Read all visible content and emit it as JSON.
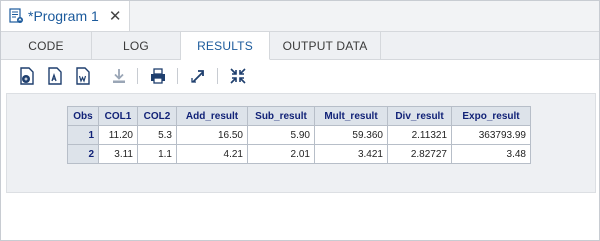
{
  "program_tab": {
    "title": "*Program 1",
    "close_icon": "close-icon"
  },
  "subtabs": [
    {
      "label": "CODE",
      "active": false
    },
    {
      "label": "LOG",
      "active": false
    },
    {
      "label": "RESULTS",
      "active": true
    },
    {
      "label": "OUTPUT DATA",
      "active": false
    }
  ],
  "toolbar": {
    "icons": [
      "download-html-icon",
      "download-pdf-icon",
      "download-rtf-icon",
      "download-icon",
      "print-icon",
      "expand-icon",
      "collapse-icon"
    ]
  },
  "table": {
    "headers": [
      "Obs",
      "COL1",
      "COL2",
      "Add_result",
      "Sub_result",
      "Mult_result",
      "Div_result",
      "Expo_result"
    ],
    "rows": [
      [
        "1",
        "11.20",
        "5.3",
        "16.50",
        "5.90",
        "59.360",
        "2.11321",
        "363793.99"
      ],
      [
        "2",
        "3.11",
        "1.1",
        "4.21",
        "2.01",
        "3.421",
        "2.82727",
        "3.48"
      ]
    ]
  },
  "colors": {
    "accent": "#1b5a9c",
    "header_bg": "#dde3ea",
    "header_text": "#112277"
  }
}
